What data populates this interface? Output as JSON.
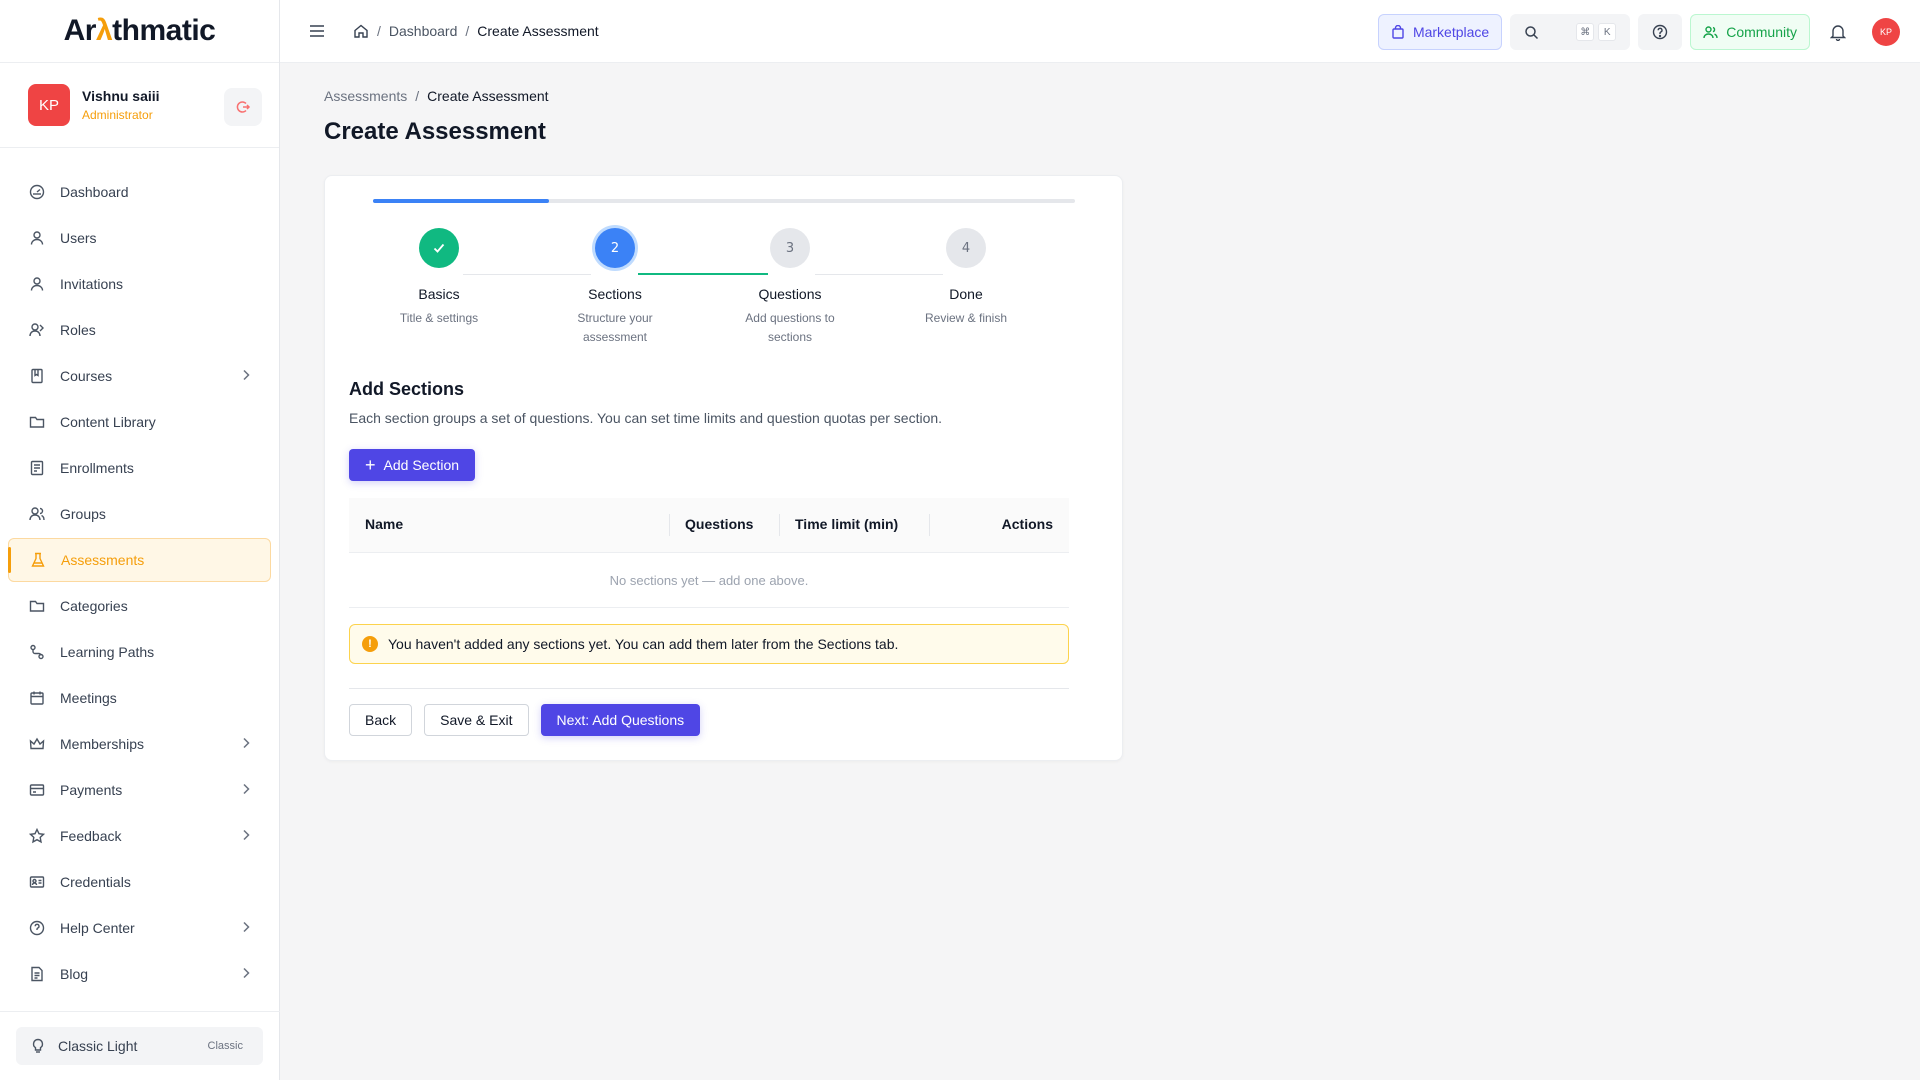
{
  "brand": {
    "logo_prefix": "Ar",
    "logo_accent": "λ",
    "logo_suffix": "thmatic"
  },
  "profile": {
    "initials": "KP",
    "name": "Vishnu saiii",
    "role": "Administrator"
  },
  "sidebar": {
    "items": [
      {
        "label": "Dashboard",
        "icon": "dashboard-icon"
      },
      {
        "label": "Users",
        "icon": "user-icon"
      },
      {
        "label": "Invitations",
        "icon": "user-icon"
      },
      {
        "label": "Roles",
        "icon": "roles-icon"
      },
      {
        "label": "Courses",
        "icon": "book-icon",
        "expandable": true
      },
      {
        "label": "Content Library",
        "icon": "folder-icon"
      },
      {
        "label": "Enrollments",
        "icon": "list-icon"
      },
      {
        "label": "Groups",
        "icon": "group-icon"
      },
      {
        "label": "Assessments",
        "icon": "flask-icon",
        "active": true
      },
      {
        "label": "Categories",
        "icon": "folder-icon"
      },
      {
        "label": "Learning Paths",
        "icon": "route-icon"
      },
      {
        "label": "Meetings",
        "icon": "calendar-icon"
      },
      {
        "label": "Memberships",
        "icon": "crown-icon",
        "expandable": true
      },
      {
        "label": "Payments",
        "icon": "card-icon",
        "expandable": true
      },
      {
        "label": "Feedback",
        "icon": "star-icon",
        "expandable": true
      },
      {
        "label": "Credentials",
        "icon": "id-card-icon"
      },
      {
        "label": "Help Center",
        "icon": "help-icon",
        "expandable": true
      },
      {
        "label": "Blog",
        "icon": "document-icon",
        "expandable": true
      }
    ],
    "theme": {
      "label": "Classic Light",
      "tag": "Classic"
    }
  },
  "topbar": {
    "breadcrumb": [
      "Dashboard",
      "Create Assessment"
    ],
    "marketplace_label": "Marketplace",
    "search_kbd": [
      "⌘",
      "K"
    ],
    "community_label": "Community",
    "avatar_initials": "KP"
  },
  "page": {
    "breadcrumb": [
      "Assessments",
      "Create Assessment"
    ],
    "title": "Create Assessment"
  },
  "wizard": {
    "progress": 0.25,
    "steps": [
      {
        "number": "1",
        "title": "Basics",
        "subtitle": "Title & settings",
        "state": "done"
      },
      {
        "number": "2",
        "title": "Sections",
        "subtitle": "Structure your assessment",
        "state": "current"
      },
      {
        "number": "3",
        "title": "Questions",
        "subtitle": "Add questions to sections",
        "state": "pending"
      },
      {
        "number": "4",
        "title": "Done",
        "subtitle": "Review & finish",
        "state": "pending"
      }
    ]
  },
  "sections": {
    "title": "Add Sections",
    "description": "Each section groups a set of questions. You can set time limits and question quotas per section.",
    "add_button": "Add Section",
    "table": {
      "columns": [
        "Name",
        "Questions",
        "Time limit (min)",
        "Actions"
      ],
      "empty_text": "No sections yet — add one above."
    },
    "alert": "You haven't added any sections yet. You can add them later from the Sections tab."
  },
  "actions": {
    "back": "Back",
    "save_exit": "Save & Exit",
    "next": "Next: Add Questions"
  },
  "colors": {
    "accent": "#f59e0b",
    "primary": "#4f46e5",
    "success": "#10b981",
    "step_current": "#3b82f6"
  }
}
